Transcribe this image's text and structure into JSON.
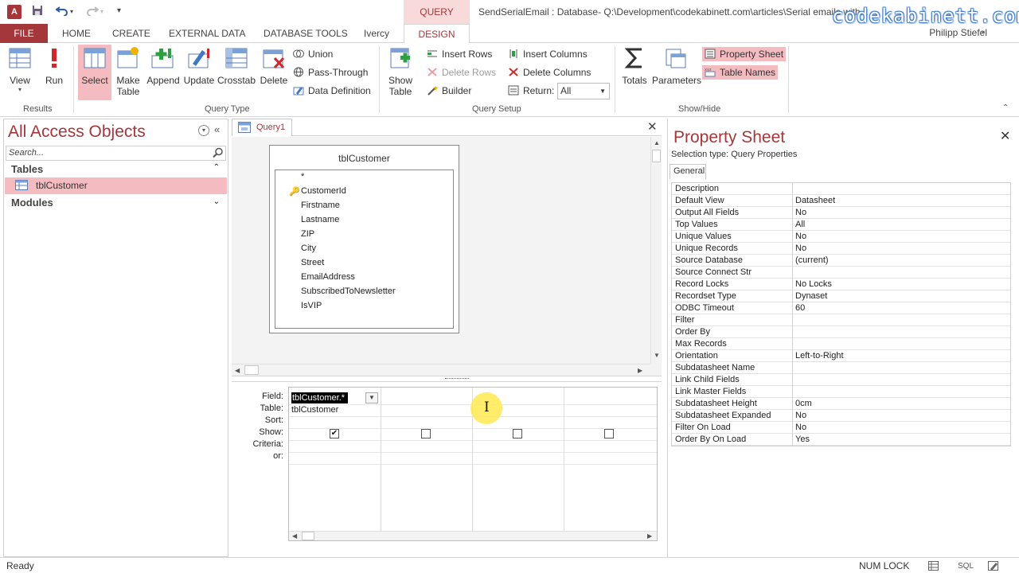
{
  "titlebar": {
    "app_icon": "A",
    "context_tab_header": "QUERY TOOLS",
    "window_title": "SendSerialEmail : Database- Q:\\Development\\codekabinett.com\\articles\\Serial emails with...",
    "watermark": "codekabinett.com",
    "undo_icon": "undo-icon",
    "redo_icon": "redo-icon",
    "save_icon": "save-icon"
  },
  "tabs": {
    "file": "FILE",
    "home": "HOME",
    "create": "CREATE",
    "external_data": "EXTERNAL DATA",
    "database_tools": "DATABASE TOOLS",
    "ivercy": "Ivercy",
    "design": "DESIGN",
    "user": "Philipp Stiefel"
  },
  "ribbon": {
    "results": {
      "label": "Results",
      "view": "View",
      "run": "Run"
    },
    "query_type": {
      "label": "Query Type",
      "select": "Select",
      "make_table_1": "Make",
      "make_table_2": "Table",
      "append": "Append",
      "update": "Update",
      "crosstab": "Crosstab",
      "delete": "Delete",
      "union": "Union",
      "pass_through": "Pass-Through",
      "data_definition": "Data Definition"
    },
    "query_setup": {
      "label": "Query Setup",
      "show_table_1": "Show",
      "show_table_2": "Table",
      "insert_rows": "Insert Rows",
      "delete_rows": "Delete Rows",
      "builder": "Builder",
      "insert_columns": "Insert Columns",
      "delete_columns": "Delete Columns",
      "return_label": "Return:",
      "return_value": "All"
    },
    "show_hide": {
      "label": "Show/Hide",
      "totals": "Totals",
      "parameters": "Parameters",
      "property_sheet": "Property Sheet",
      "table_names": "Table Names"
    }
  },
  "nav": {
    "title": "All Access Objects",
    "search_placeholder": "Search...",
    "tables_header": "Tables",
    "table_item": "tblCustomer",
    "modules_header": "Modules"
  },
  "query": {
    "tab_label": "Query1",
    "table_box": {
      "title": "tblCustomer",
      "fields": [
        "*",
        "CustomerId",
        "Firstname",
        "Lastname",
        "ZIP",
        "City",
        "Street",
        "EmailAddress",
        "SubscribedToNewsletter",
        "IsVIP"
      ]
    },
    "grid": {
      "row_labels": [
        "Field:",
        "Table:",
        "Sort:",
        "Show:",
        "Criteria:",
        "or:"
      ],
      "field_value": "tblCustomer.*",
      "table_value": "tblCustomer",
      "show_checked": [
        true,
        false,
        false,
        false
      ]
    }
  },
  "property_sheet": {
    "title": "Property Sheet",
    "selection_type": "Selection type:  Query Properties",
    "tab_general": "General",
    "rows": [
      {
        "key": "Description",
        "value": ""
      },
      {
        "key": "Default View",
        "value": "Datasheet"
      },
      {
        "key": "Output All Fields",
        "value": "No"
      },
      {
        "key": "Top Values",
        "value": "All"
      },
      {
        "key": "Unique Values",
        "value": "No"
      },
      {
        "key": "Unique Records",
        "value": "No"
      },
      {
        "key": "Source Database",
        "value": "(current)"
      },
      {
        "key": "Source Connect Str",
        "value": ""
      },
      {
        "key": "Record Locks",
        "value": "No Locks"
      },
      {
        "key": "Recordset Type",
        "value": "Dynaset"
      },
      {
        "key": "ODBC Timeout",
        "value": "60"
      },
      {
        "key": "Filter",
        "value": ""
      },
      {
        "key": "Order By",
        "value": ""
      },
      {
        "key": "Max Records",
        "value": ""
      },
      {
        "key": "Orientation",
        "value": "Left-to-Right"
      },
      {
        "key": "Subdatasheet Name",
        "value": ""
      },
      {
        "key": "Link Child Fields",
        "value": ""
      },
      {
        "key": "Link Master Fields",
        "value": ""
      },
      {
        "key": "Subdatasheet Height",
        "value": "0cm"
      },
      {
        "key": "Subdatasheet Expanded",
        "value": "No"
      },
      {
        "key": "Filter On Load",
        "value": "No"
      },
      {
        "key": "Order By On Load",
        "value": "Yes"
      }
    ]
  },
  "status": {
    "ready": "Ready",
    "numlock": "NUM LOCK",
    "sql_label": "SQL"
  },
  "colors": {
    "accent": "#a4373a",
    "selected": "#f4bcc0",
    "context_tab": "#f9dadb"
  }
}
